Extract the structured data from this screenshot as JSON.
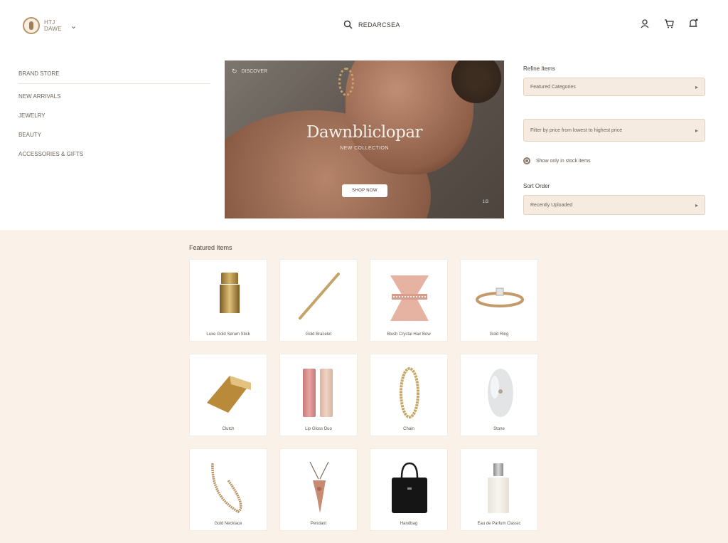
{
  "header": {
    "brand_line1": "HTJ",
    "brand_line2": "DAWE",
    "search_label": "REDARCSEA",
    "icons": [
      "user-icon",
      "cart-icon",
      "bell-icon"
    ]
  },
  "sidebar": {
    "items": [
      {
        "label": "BRAND STORE"
      },
      {
        "label": "NEW ARRIVALS"
      },
      {
        "label": "JEWELRY"
      },
      {
        "label": "BEAUTY"
      },
      {
        "label": "ACCESSORIES & GIFTS"
      }
    ]
  },
  "hero": {
    "tag": "DISCOVER",
    "title": "Dawnbliclopar",
    "subtitle": "NEW COLLECTION",
    "button_label": "SHOP NOW",
    "counter": "1/3"
  },
  "filters": {
    "section_label": "Refine Items",
    "select_1": "Featured Categories",
    "select_2": "Filter by price from lowest to highest price",
    "radio_label": "Show only in stock items",
    "section_label_2": "Sort Order",
    "select_3": "Recently Uploaded"
  },
  "products": {
    "section_title": "Featured Items",
    "items": [
      {
        "name": "Luxe Gold Serum Stick",
        "icon": "lipstick-icon"
      },
      {
        "name": "Gold Bracelet",
        "icon": "bracelet-icon"
      },
      {
        "name": "Blush Crystal Hair Bow",
        "icon": "bow-icon"
      },
      {
        "name": "Gold Ring",
        "icon": "ring-icon"
      },
      {
        "name": "Clutch",
        "icon": "clutch-icon"
      },
      {
        "name": "Lip Gloss Duo",
        "icon": "lipgloss-icon"
      },
      {
        "name": "Chain",
        "icon": "chain-icon"
      },
      {
        "name": "Stone",
        "icon": "stone-icon"
      },
      {
        "name": "Gold Necklace",
        "icon": "necklace-icon"
      },
      {
        "name": "Pendant",
        "icon": "pendant-icon"
      },
      {
        "name": "Handbag",
        "icon": "handbag-icon"
      },
      {
        "name": "Eau de Parfum Classic",
        "icon": "perfume-icon"
      }
    ]
  },
  "colors": {
    "accent_gold": "#b99466",
    "band_background": "#faf1e8",
    "select_background": "#f5ebe0"
  }
}
